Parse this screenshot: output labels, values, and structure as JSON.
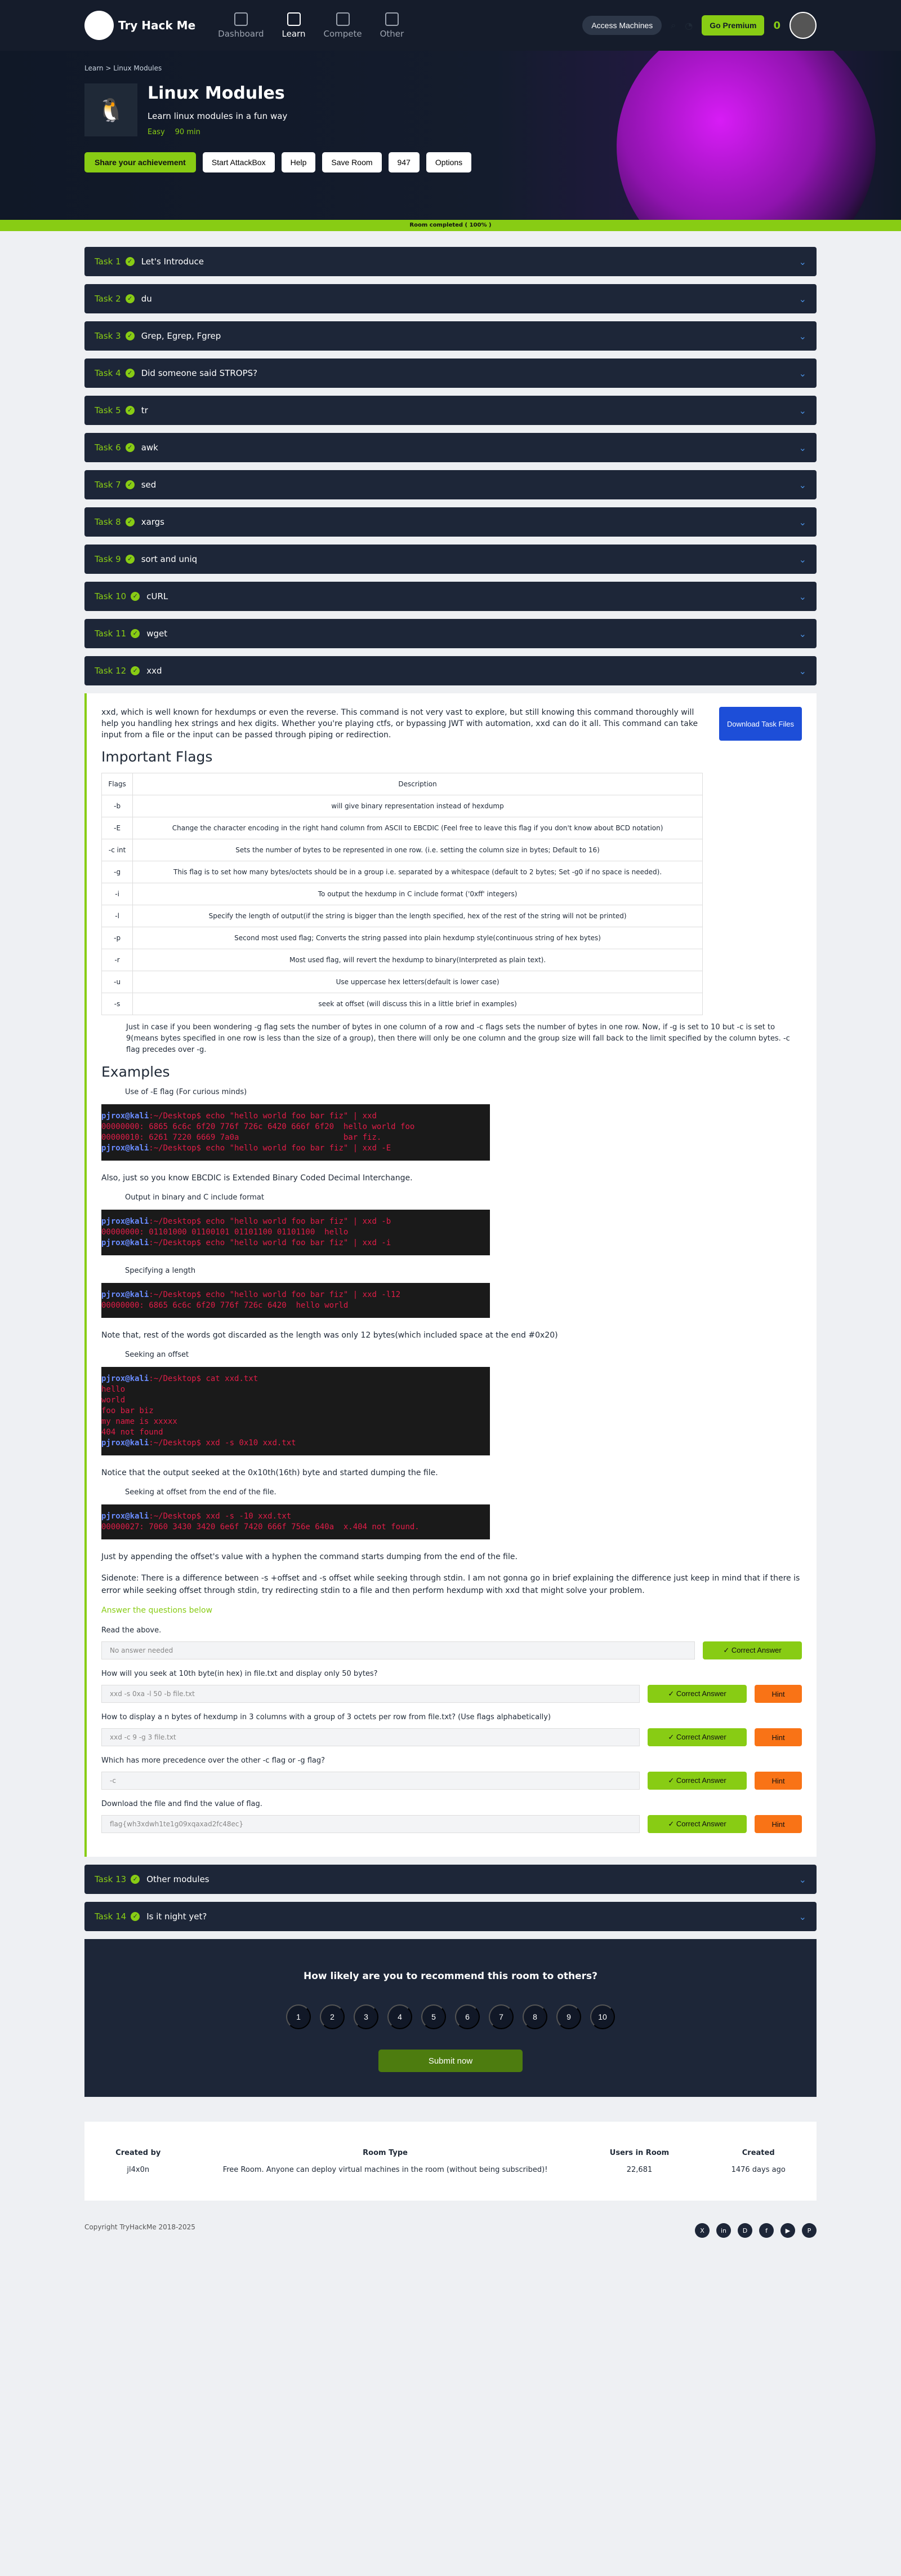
{
  "nav": {
    "logo": "Try\nHack\nMe",
    "links": [
      "Dashboard",
      "Learn",
      "Compete",
      "Other"
    ],
    "access": "Access Machines",
    "premium": "Go Premium",
    "streak": "0"
  },
  "hero": {
    "breadcrumb": "Learn > Linux Modules",
    "title": "Linux Modules",
    "subtitle": "Learn linux modules in a fun way",
    "difficulty": "Easy",
    "time": "90 min",
    "actions": [
      "Share your achievement",
      "Start AttackBox",
      "Help",
      "Save Room",
      "947",
      "Options"
    ]
  },
  "progress": "Room completed ( 100% )",
  "tasks": [
    {
      "no": "Task 1",
      "name": "Let's Introduce"
    },
    {
      "no": "Task 2",
      "name": "du"
    },
    {
      "no": "Task 3",
      "name": "Grep, Egrep, Fgrep"
    },
    {
      "no": "Task 4",
      "name": "Did someone said STROPS?"
    },
    {
      "no": "Task 5",
      "name": "tr"
    },
    {
      "no": "Task 6",
      "name": "awk"
    },
    {
      "no": "Task 7",
      "name": "sed"
    },
    {
      "no": "Task 8",
      "name": "xargs"
    },
    {
      "no": "Task 9",
      "name": "sort and uniq"
    },
    {
      "no": "Task 10",
      "name": "cURL"
    },
    {
      "no": "Task 11",
      "name": "wget"
    },
    {
      "no": "Task 12",
      "name": "xxd"
    }
  ],
  "open_task": {
    "intro": "xxd, which is well known for hexdumps or even the reverse. This command is not very vast to explore, but still knowing this command thoroughly will help you handling hex strings and hex digits. Whether you're playing ctfs, or bypassing JWT with automation, xxd can do it all. This command can take input from a file or the input can be passed through piping or redirection.",
    "download": "Download Task Files",
    "flags_title": "Important Flags",
    "table": [
      [
        "Flags",
        "Description"
      ],
      [
        "-b",
        "will give binary representation instead of hexdump"
      ],
      [
        "-E",
        "Change the character encoding in the right hand column from ASCII to EBCDIC (Feel free to leave this flag if you don't know about BCD notation)"
      ],
      [
        "-c int",
        "Sets the number of bytes to be represented in one row. (i.e. setting the column size in bytes; Default to 16)"
      ],
      [
        "-g",
        "This flag is to set how many bytes/octets should be in a group i.e. separated by a whitespace (default to 2 bytes; Set -g0 if no space is needed)."
      ],
      [
        "-i",
        "To output the hexdump in C include format ('0xff' integers)"
      ],
      [
        "-l",
        "Specify the length of output(if the string is bigger than the length specified, hex of the rest of the string will not be printed)"
      ],
      [
        "-p",
        "Second most used flag; Converts the string passed into plain hexdump style(continuous string of hex bytes)"
      ],
      [
        "-r",
        "Most used flag, will revert the hexdump to binary(Interpreted as plain text)."
      ],
      [
        "-u",
        "Use uppercase hex letters(default is lower case)"
      ],
      [
        "-s",
        "seek at offset (will discuss this in a little brief in examples)"
      ]
    ],
    "note": "Just in case if you been wondering -g flag sets the number of bytes in one column of a row and -c flags sets the number of bytes in one row. Now, if -g is set to 10 but -c is set to 9(means bytes specified in one row is less than the size of a group), then there will only be one column and the group size will fall back to the limit specified by the column bytes. -c flag precedes over -g.",
    "examples": "Examples",
    "bullets": [
      "Use of -E flag (For curious minds)",
      "Output in binary and C include format",
      "Specifying a length",
      "Seeking an offset",
      "Seeking at offset from the end of the file."
    ],
    "texts": [
      "Also, just so you know EBCDIC is Extended Binary Coded Decimal Interchange.",
      "Note that, rest of the words got discarded as the length was only 12 bytes(which included space at the end #0x20)",
      "Notice that the output seeked at the 0x10th(16th) byte and started dumping the file.",
      "Just by appending the offset's value with a hyphen the command starts dumping from the end of the file.",
      "Sidenote: There is a difference between -s +offset and -s offset while seeking through stdin. I am not gonna go in brief explaining the difference just keep in mind that if there is error while seeking offset through stdin, try redirecting stdin to a file and then perform hexdump with xxd that might solve your problem."
    ],
    "answer_title": "Answer the questions below",
    "questions": [
      [
        "Read the above.",
        "No answer needed",
        false
      ],
      [
        "How will you seek at 10th byte(in hex) in file.txt and display only 50 bytes?",
        "xxd -s 0xa -l 50 -b file.txt",
        true
      ],
      [
        "How to display a n bytes of hexdump in 3 columns with a group of 3 octets per row from file.txt? (Use flags alphabetically)",
        "xxd -c 9 -g 3 file.txt",
        true
      ],
      [
        "Which has more precedence over the other -c flag or -g flag?",
        "-c",
        true
      ],
      [
        "Download the file and find the value of flag.",
        "flag{wh3xdwh1te1g09xqaxad2fc48ec}",
        true
      ]
    ],
    "correct": "Correct Answer",
    "hint": "Hint"
  },
  "more_tasks": [
    {
      "no": "Task 13",
      "name": "Other modules"
    },
    {
      "no": "Task 14",
      "name": "Is it night yet?"
    }
  ],
  "feedback": {
    "title": "How likely are you to recommend this room to others?",
    "submit": "Submit now"
  },
  "footer": {
    "created_by": "Created by",
    "user": "jl4x0n",
    "type": "Room Type",
    "type_value": "Free Room. Anyone can deploy virtual machines in the room (without being subscribed)!",
    "users": "Users in Room",
    "users_value": "22,681",
    "created": "Created",
    "created_value": "1476 days ago",
    "copyright": "Copyright TryHackMe 2018-2025"
  }
}
